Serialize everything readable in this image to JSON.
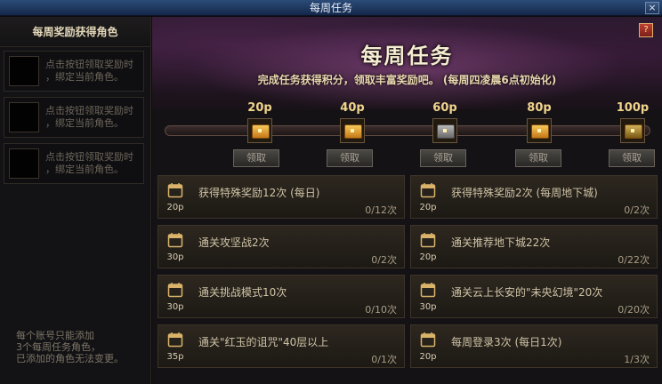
{
  "window": {
    "title": "每周任务",
    "close_label": "×"
  },
  "left_panel": {
    "title": "每周奖励获得角色",
    "slots": [
      {
        "text": "点击按钮领取奖励时\n，绑定当前角色。"
      },
      {
        "text": "点击按钮领取奖励时\n，绑定当前角色。"
      },
      {
        "text": "点击按钮领取奖励时\n，绑定当前角色。"
      }
    ],
    "note": "每个账号只能添加\n3个每周任务角色，\n已添加的角色无法变更。"
  },
  "banner": {
    "title": "每周任务",
    "subtitle": "完成任务获得积分，领取丰富奖励吧。 (每周四凌晨6点初始化)"
  },
  "progress": {
    "milestones": [
      {
        "points": "20p",
        "chest": "gold",
        "button": "领取"
      },
      {
        "points": "40p",
        "chest": "gold",
        "button": "领取"
      },
      {
        "points": "60p",
        "chest": "silver",
        "button": "领取"
      },
      {
        "points": "80p",
        "chest": "gold",
        "button": "领取"
      },
      {
        "points": "100p",
        "chest": "dark-gold",
        "button": "领取"
      }
    ]
  },
  "quests": [
    {
      "name": "获得特殊奖励12次 (每日)",
      "points": "20p",
      "progress": "0/12次"
    },
    {
      "name": "获得特殊奖励2次 (每周地下城)",
      "points": "20p",
      "progress": "0/2次"
    },
    {
      "name": "通关攻坚战2次",
      "points": "30p",
      "progress": "0/2次"
    },
    {
      "name": "通关推荐地下城22次",
      "points": "20p",
      "progress": "0/22次"
    },
    {
      "name": "通关挑战模式10次",
      "points": "30p",
      "progress": "0/10次"
    },
    {
      "name": "通关云上长安的\"未央幻境\"20次",
      "points": "30p",
      "progress": "0/20次"
    },
    {
      "name": "通关\"红玉的诅咒\"40层以上",
      "points": "35p",
      "progress": "0/1次"
    },
    {
      "name": "每周登录3次 (每日1次)",
      "points": "20p",
      "progress": "1/3次"
    }
  ],
  "colors": {
    "accent": "#f0d48c",
    "card_bg": "#2d271f",
    "title_bar": "#2b4c78"
  },
  "icons": {
    "quest": "calendar-check-icon",
    "book": "book-icon",
    "chest": "treasure-chest-icon"
  }
}
